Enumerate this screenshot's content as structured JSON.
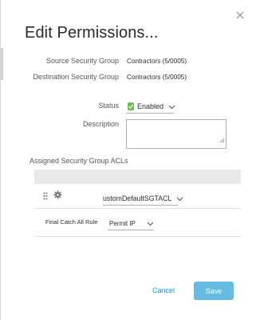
{
  "dialog": {
    "title": "Edit Permissions..."
  },
  "fields": {
    "source_label": "Source Security Group",
    "source_value": "Contractors (5/0005)",
    "destination_label": "Destination Security Group",
    "destination_value": "Contractors (5/0005)",
    "status_label": "Status",
    "status_value": "Enabled",
    "status_checked": true,
    "description_label": "Description",
    "description_value": ""
  },
  "acls": {
    "section_title": "Assigned Security Group ACLs",
    "rows": [
      {
        "selected": "ustomDefaultSGTACL"
      }
    ],
    "final_catch_label": "Final Catch All Rule",
    "final_catch_value": "Permit IP"
  },
  "buttons": {
    "cancel": "Cancel",
    "save": "Save"
  },
  "colors": {
    "accent": "#049fd9",
    "primary_button": "#64bbe3",
    "check_green": "#6cc04a"
  },
  "icons": {
    "close": "close-icon",
    "checkbox": "checkbox-checked-icon",
    "chevron": "chevron-down-icon",
    "drag": "drag-handle-icon",
    "gear": "gear-icon",
    "resize": "resize-handle-icon"
  }
}
